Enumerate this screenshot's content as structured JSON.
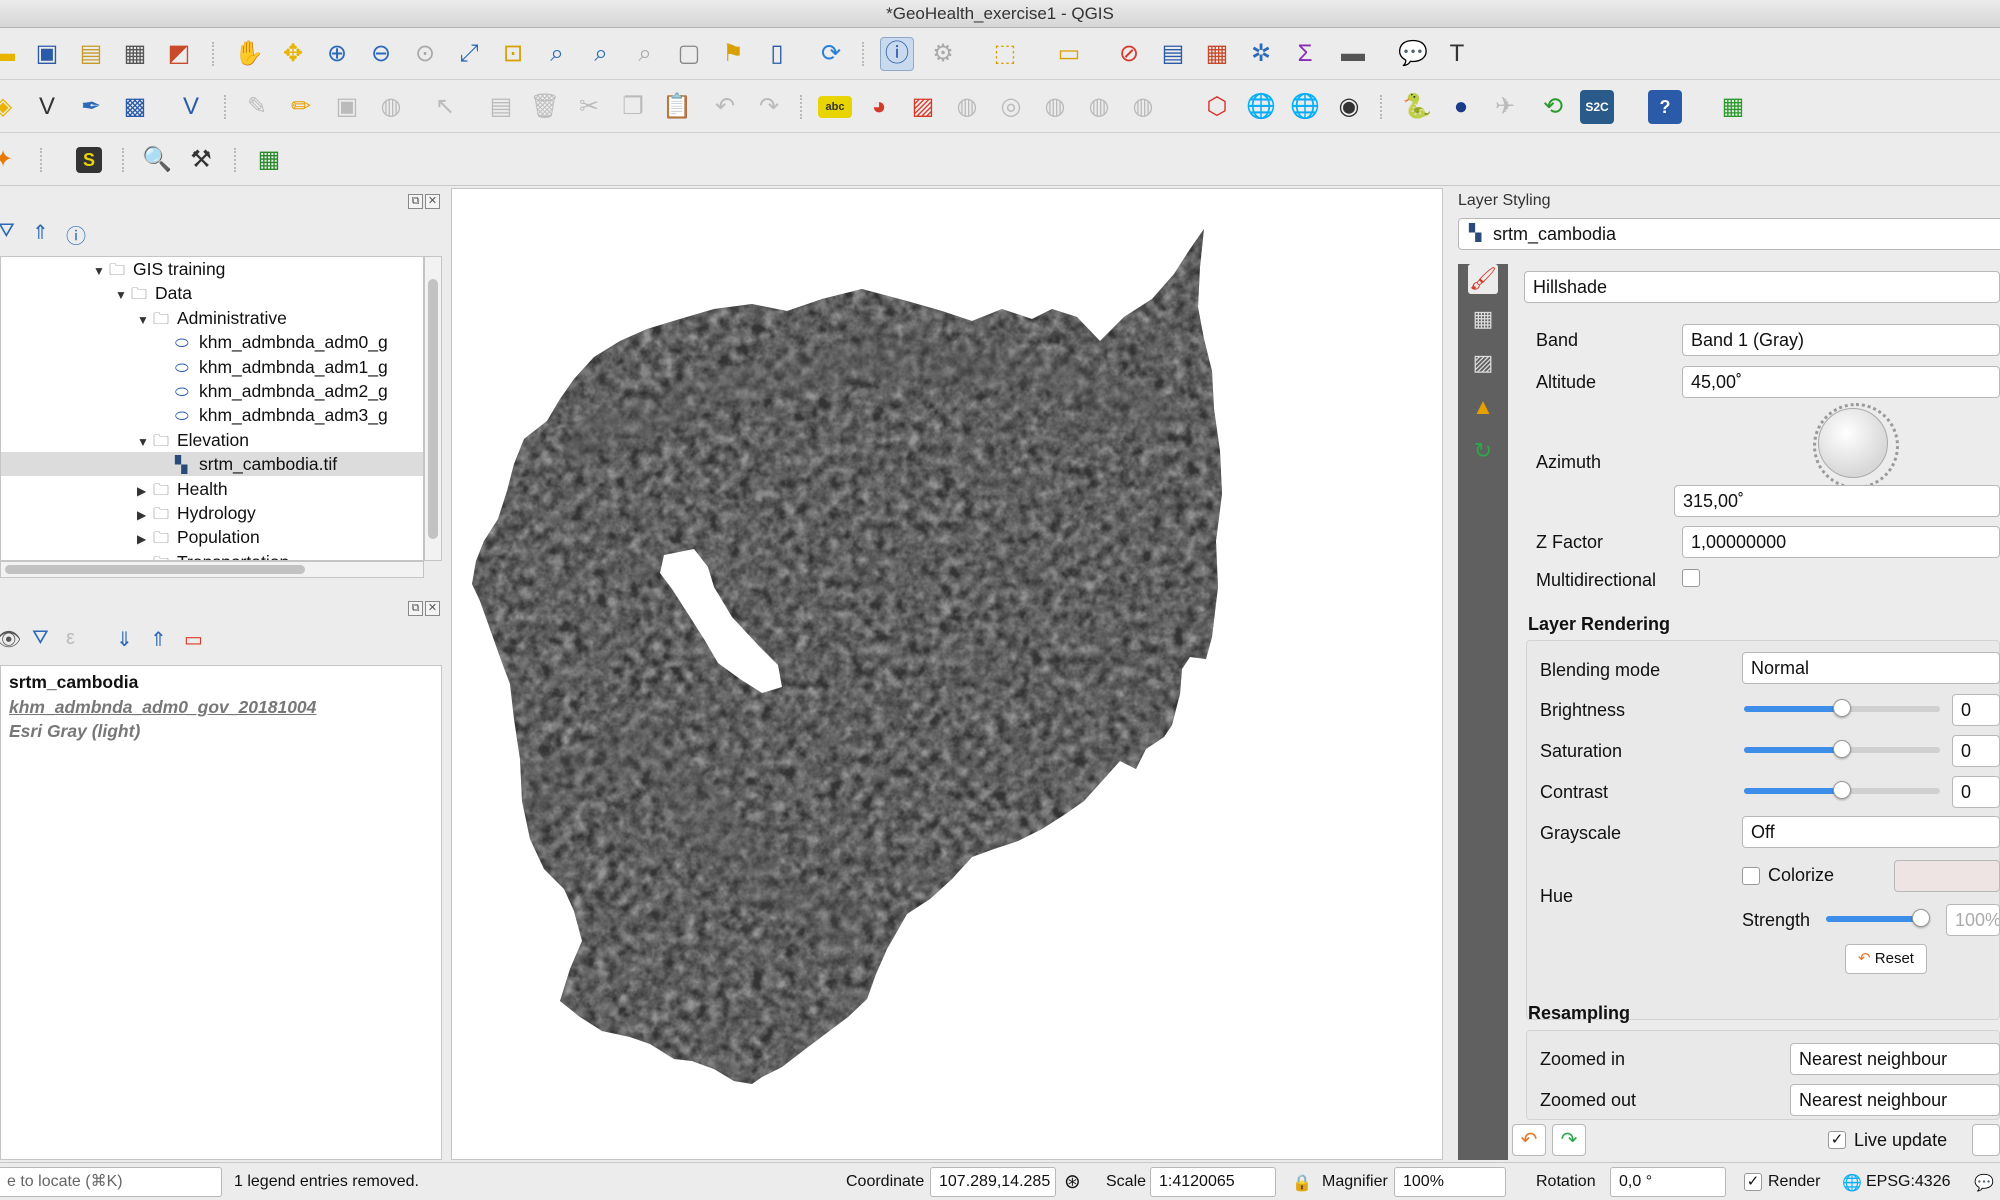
{
  "window": {
    "title": "*GeoHealth_exercise1 - QGIS"
  },
  "browser_panel": {
    "tree": [
      {
        "label": "GIS training",
        "level": 0,
        "expanded": true,
        "type": "folder"
      },
      {
        "label": "Data",
        "level": 1,
        "expanded": true,
        "type": "folder"
      },
      {
        "label": "Administrative",
        "level": 2,
        "expanded": true,
        "type": "folder"
      },
      {
        "label": "khm_admbnda_adm0_g",
        "level": 3,
        "type": "vector"
      },
      {
        "label": "khm_admbnda_adm1_g",
        "level": 3,
        "type": "vector"
      },
      {
        "label": "khm_admbnda_adm2_g",
        "level": 3,
        "type": "vector"
      },
      {
        "label": "khm_admbnda_adm3_g",
        "level": 3,
        "type": "vector"
      },
      {
        "label": "Elevation",
        "level": 2,
        "expanded": true,
        "type": "folder"
      },
      {
        "label": "srtm_cambodia.tif",
        "level": 3,
        "type": "raster",
        "selected": true
      },
      {
        "label": "Health",
        "level": 2,
        "expanded": false,
        "type": "folder"
      },
      {
        "label": "Hydrology",
        "level": 2,
        "expanded": false,
        "type": "folder"
      },
      {
        "label": "Population",
        "level": 2,
        "expanded": false,
        "type": "folder"
      },
      {
        "label": "Transportation",
        "level": 2,
        "expanded": false,
        "type": "folder"
      }
    ]
  },
  "layers_panel": {
    "layers": [
      {
        "label": "srtm_cambodia",
        "style": "bold"
      },
      {
        "label": "khm_admbnda_adm0_gov_20181004",
        "style": "italic-underline"
      },
      {
        "label": "Esri Gray (light)",
        "style": "italic"
      }
    ]
  },
  "layer_styling": {
    "title": "Layer Styling",
    "layer": "srtm_cambodia",
    "renderer": "Hillshade",
    "band_label": "Band",
    "band_value": "Band 1 (Gray)",
    "altitude_label": "Altitude",
    "altitude_value": "45,00˚",
    "azimuth_label": "Azimuth",
    "azimuth_value": "315,00˚",
    "zfactor_label": "Z Factor",
    "zfactor_value": "1,00000000",
    "multidirectional_label": "Multidirectional",
    "multidirectional_checked": false,
    "layer_rendering": {
      "title": "Layer Rendering",
      "blending_label": "Blending mode",
      "blending_value": "Normal",
      "brightness_label": "Brightness",
      "brightness_value": "0",
      "brightness_level": 0.5,
      "saturation_label": "Saturation",
      "saturation_value": "0",
      "saturation_level": 0.5,
      "contrast_label": "Contrast",
      "contrast_value": "0",
      "contrast_level": 0.5,
      "grayscale_label": "Grayscale",
      "grayscale_value": "Off",
      "hue_label": "Hue",
      "colorize_label": "Colorize",
      "colorize_checked": false,
      "strength_label": "Strength",
      "strength_value": "100%",
      "strength_level": 1.0,
      "reset_label": "Reset"
    },
    "resampling": {
      "title": "Resampling",
      "zoomed_in_label": "Zoomed in",
      "zoomed_in_value": "Nearest neighbour",
      "zoomed_out_label": "Zoomed out",
      "zoomed_out_value": "Nearest neighbour"
    },
    "live_update_label": "Live update",
    "live_update_checked": true
  },
  "status_bar": {
    "locator_placeholder": "e to locate (⌘K)",
    "message": "1 legend entries removed.",
    "coordinate_label": "Coordinate",
    "coordinate_value": "107.289,14.285",
    "scale_label": "Scale",
    "scale_value": "1:4120065",
    "magnifier_label": "Magnifier",
    "magnifier_value": "100%",
    "rotation_label": "Rotation",
    "rotation_value": "0,0 °",
    "render_label": "Render",
    "render_checked": true,
    "crs": "EPSG:4326"
  },
  "colors": {
    "accent": "#3d8ee8",
    "hillshade": "#3a3a3a",
    "selected_row": "#dcdcdc"
  }
}
